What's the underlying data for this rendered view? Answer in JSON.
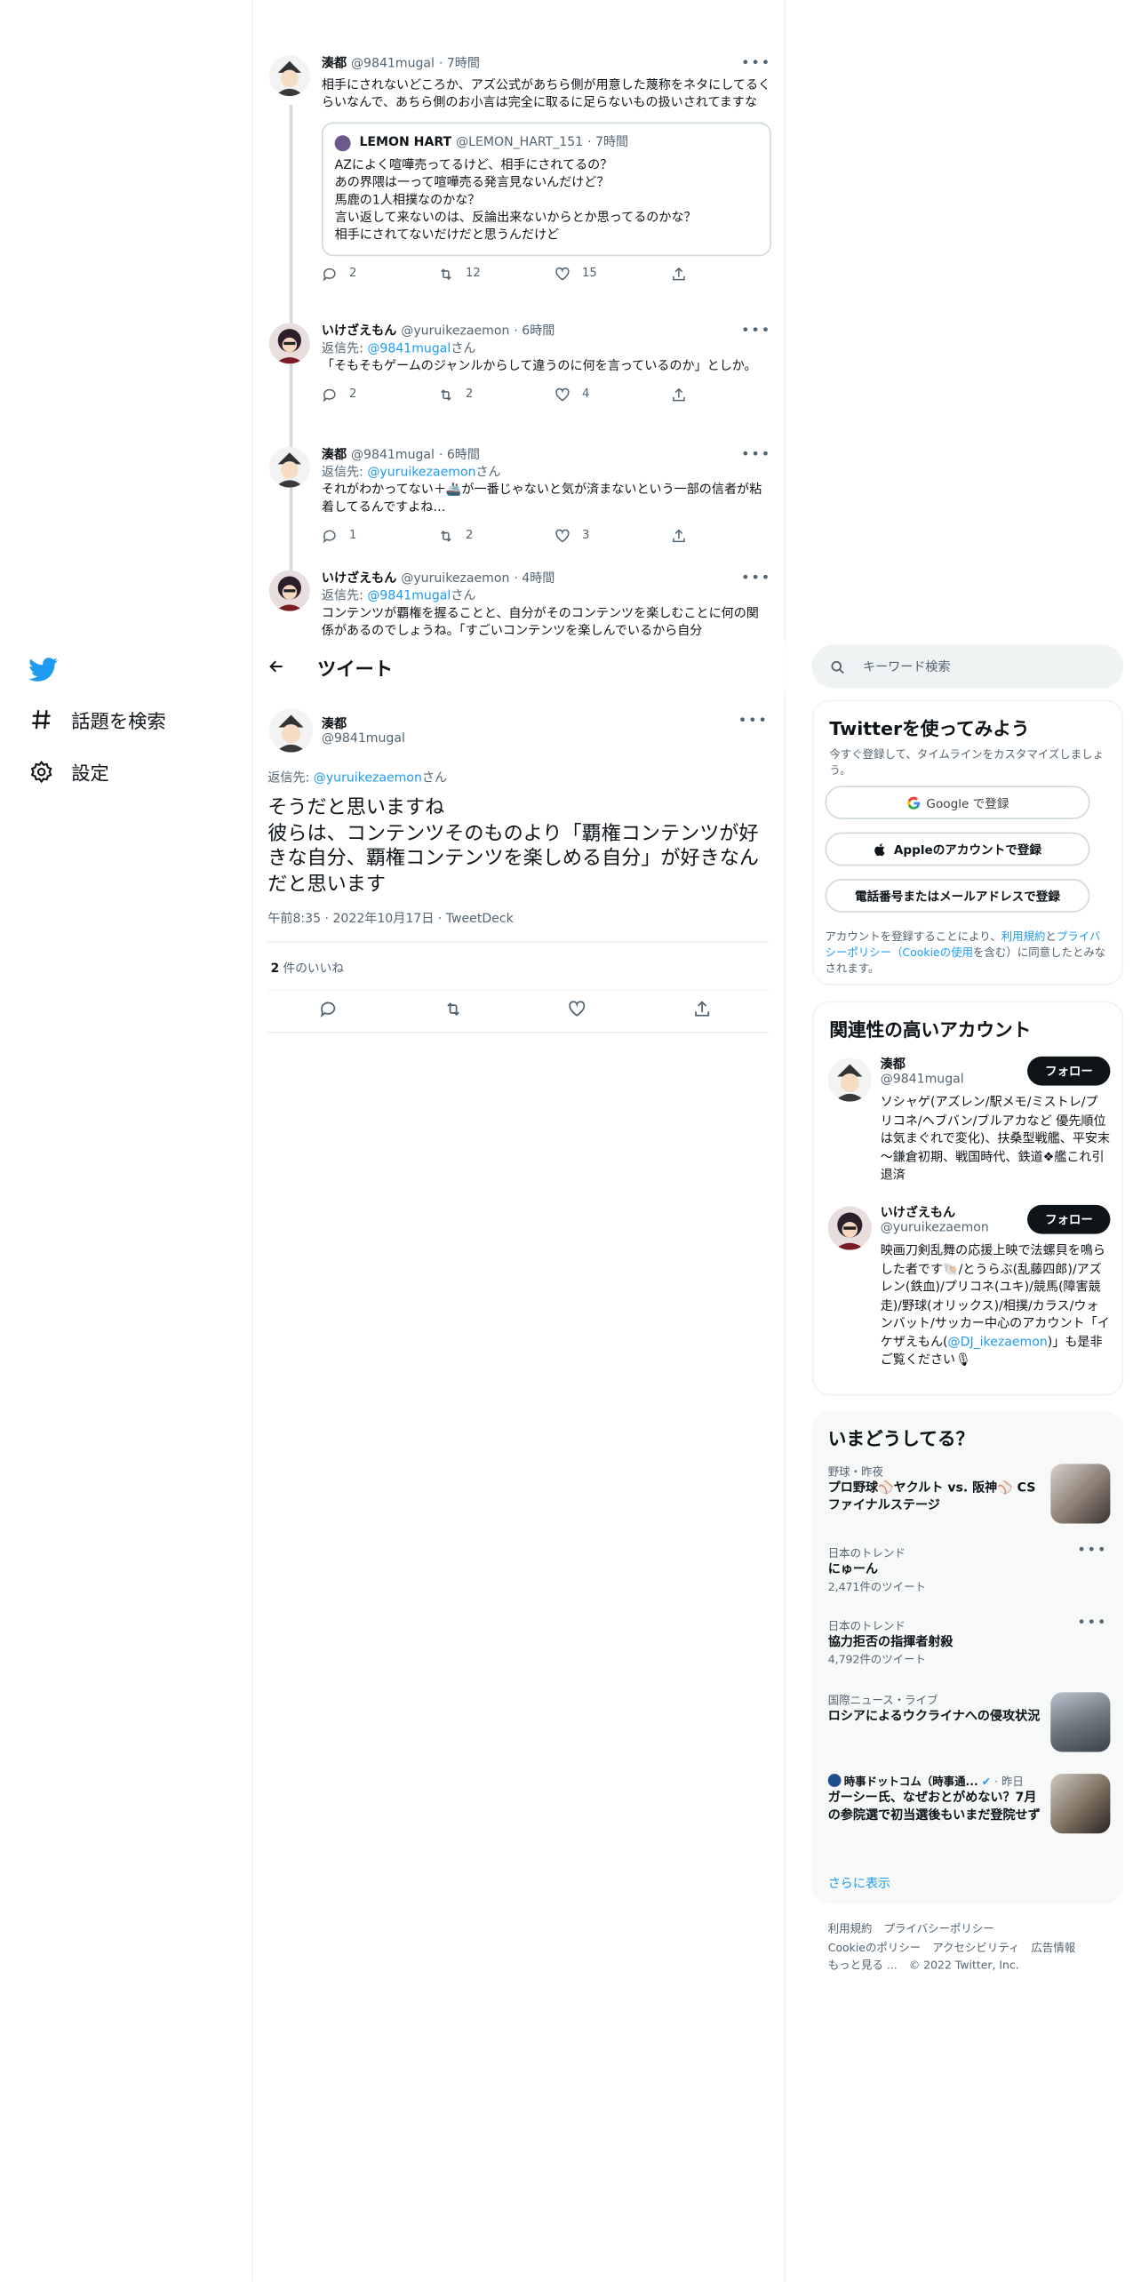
{
  "nav": {
    "items": [
      {
        "label": "話題を検索",
        "icon": "hashtag-icon"
      },
      {
        "label": "設定",
        "icon": "gear-icon"
      }
    ]
  },
  "thread": {
    "tweets": [
      {
        "name": "湊都",
        "handle": "@9841mugal",
        "time": "· 7時間",
        "text": "相手にされないどころか、アズ公式があちら側が用意した蔑称をネタにしてるくらいなんで、あちら側のお小言は完全に取るに足らないもの扱いされてますな",
        "quote": {
          "name": "LEMON HART",
          "handle": "@LEMON_HART_151",
          "time": "· 7時間",
          "text": "AZによく喧嘩売ってるけど、相手にされてるの？\nあの界隈は一って喧嘩売る発言見ないんだけど？\n馬鹿の1人相撲なのかな？\n言い返して来ないのは、反論出来ないからとか思ってるのかな？\n相手にされてないだけだと思うんだけど"
        },
        "reply": "2",
        "retweet": "12",
        "like": "15"
      },
      {
        "name": "いけざえもん",
        "handle": "@yuruikezaemon",
        "time": "· 6時間",
        "reply_to_prefix": "返信先: ",
        "reply_to": "@9841mugal",
        "reply_to_suffix": "さん",
        "text": "「そもそもゲームのジャンルからして違うのに何を言っているのか」としか。",
        "reply": "2",
        "retweet": "2",
        "like": "4"
      },
      {
        "name": "湊都",
        "handle": "@9841mugal",
        "time": "· 6時間",
        "reply_to_prefix": "返信先: ",
        "reply_to": "@yuruikezaemon",
        "reply_to_suffix": "さん",
        "text": "それがわかってない＋🚢が一番じゃないと気が済まないという一部の信者が粘着してるんですよね…",
        "reply": "1",
        "retweet": "2",
        "like": "3"
      },
      {
        "name": "いけざえもん",
        "handle": "@yuruikezaemon",
        "time": "· 4時間",
        "reply_to_prefix": "返信先: ",
        "reply_to": "@9841mugal",
        "reply_to_suffix": "さん",
        "text": "コンテンツが覇権を握ることと、自分がそのコンテンツを楽しむことに何の関係があるのでしょうね。「すごいコンテンツを楽しんでいるから自分"
      }
    ]
  },
  "header": {
    "title": "ツイート"
  },
  "main_tweet": {
    "name": "湊都",
    "handle": "@9841mugal",
    "reply_to_prefix": "返信先: ",
    "reply_to": "@yuruikezaemon",
    "reply_to_suffix": "さん",
    "text": "そうだと思いますね\n彼らは、コンテンツそのものより「覇権コンテンツが好きな自分、覇権コンテンツを楽しめる自分」が好きなんだと思います",
    "meta": "午前8:35 · 2022年10月17日 · TweetDeck",
    "likes_count": "2",
    "likes_label": " 件のいいね"
  },
  "search": {
    "placeholder": "キーワード検索"
  },
  "signup": {
    "title": "Twitterを使ってみよう",
    "subtitle": "今すぐ登録して、タイムラインをカスタマイズしましょう。",
    "google": "Google で登録",
    "apple": "Appleのアカウントで登録",
    "phone": "電話番号またはメールアドレスで登録",
    "legal_1": "アカウントを登録することにより、",
    "legal_terms": "利用規約",
    "legal_2": "と",
    "legal_privacy": "プライバシーポリシー（Cookieの使用",
    "legal_3": "を含む）に同意したとみなされます。"
  },
  "related": {
    "title": "関連性の高いアカウント",
    "follow": "フォロー",
    "accounts": [
      {
        "name": "湊都",
        "handle": "@9841mugal",
        "bio": "ソシャゲ(アズレン/駅メモ/ミストレ/プリコネ/ヘブバン/ブルアカなど 優先順位は気まぐれで変化)、扶桑型戦艦、平安末～鎌倉初期、戦国時代、鉄道❖艦これ引退済"
      },
      {
        "name": "いけざえもん",
        "handle": "@yuruikezaemon",
        "bio_1": "映画刀剣乱舞の応援上映で法螺貝を鳴らした者です🐚/とうらぶ(乱藤四郎)/アズレン(鉄血)/プリコネ(ユキ)/競馬(障害競走)/野球(オリックス)/相撲/カラス/ウォンバット/サッカー中心のアカウント「イケザえもん(",
        "bio_link": "@DJ_ikezaemon",
        "bio_2": ")」も是非ご覧ください🎙"
      }
    ]
  },
  "trends": {
    "title": "いまどうしてる？",
    "items": [
      {
        "category": "野球・昨夜",
        "title": "プロ野球⚾ヤクルト vs. 阪神⚾ CSファイナルステージ"
      },
      {
        "category": "日本のトレンド",
        "title": "にゅーん",
        "count": "2,471件のツイート"
      },
      {
        "category": "日本のトレンド",
        "title": "協力拒否の指揮者射殺",
        "count": "4,792件のツイート"
      },
      {
        "category": "国際ニュース・ライブ",
        "title": "ロシアによるウクライナへの侵攻状況"
      },
      {
        "category_source": "時事ドットコム（時事通...",
        "category_time": " · 昨日",
        "title": "ガーシー氏、なぜおとがめない？7月の参院選で初当選後もいまだ登院せず"
      }
    ],
    "show_more": "さらに表示"
  },
  "footer": {
    "links": [
      "利用規約",
      "プライバシーポリシー",
      "Cookieのポリシー",
      "アクセシビリティ",
      "広告情報",
      "もっと見る ..."
    ],
    "copyright": "© 2022 Twitter, Inc."
  },
  "colors": {
    "accent": "#1d9bf0",
    "text": "#0f1419",
    "secondary": "#536471"
  }
}
